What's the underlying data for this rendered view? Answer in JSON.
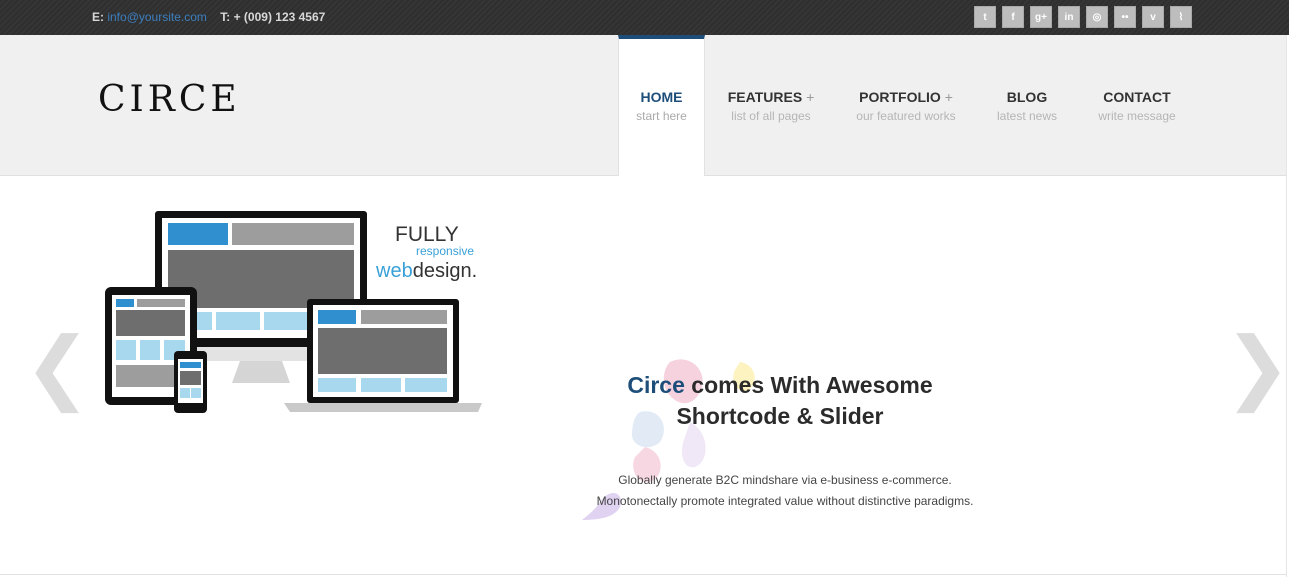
{
  "topbar": {
    "email_prefix": "E:",
    "email": "info@yoursite.com",
    "phone": "T: + (009) 123 4567",
    "social": [
      {
        "icon": "twitter-icon",
        "glyph": "t"
      },
      {
        "icon": "facebook-icon",
        "glyph": "f"
      },
      {
        "icon": "google-plus-icon",
        "glyph": "g+"
      },
      {
        "icon": "linkedin-icon",
        "glyph": "in"
      },
      {
        "icon": "dribbble-icon",
        "glyph": "◎"
      },
      {
        "icon": "flickr-icon",
        "glyph": "••"
      },
      {
        "icon": "vimeo-icon",
        "glyph": "v"
      },
      {
        "icon": "rss-icon",
        "glyph": "⌇"
      }
    ]
  },
  "header": {
    "logo": "CIRCE",
    "nav": [
      {
        "label": "HOME",
        "sub": "start here",
        "plus": "",
        "active": true
      },
      {
        "label": "FEATURES",
        "sub": "list of all pages",
        "plus": "+",
        "active": false
      },
      {
        "label": "PORTFOLIO",
        "sub": "our featured works",
        "plus": "+",
        "active": false
      },
      {
        "label": "BLOG",
        "sub": "latest news",
        "plus": "",
        "active": false
      },
      {
        "label": "CONTACT",
        "sub": "write message",
        "plus": "",
        "active": false
      }
    ]
  },
  "slider": {
    "prev_glyph": "❮",
    "next_glyph": "❯",
    "graphic_text": {
      "fully": "FULLY",
      "responsive": "responsive",
      "web": "web",
      "design": "design."
    },
    "headline_brand": "Circe",
    "headline_rest_line1": " comes With Awesome",
    "headline_line2": "Shortcode & Slider",
    "desc_line1": "Globally generate B2C mindshare via e-business e-commerce.",
    "desc_line2": "Monotonectally promote integrated value without distinctive paradigms."
  },
  "colors": {
    "accent": "#1d4e7a",
    "link": "#3b7fbf",
    "topbar": "#333333"
  }
}
